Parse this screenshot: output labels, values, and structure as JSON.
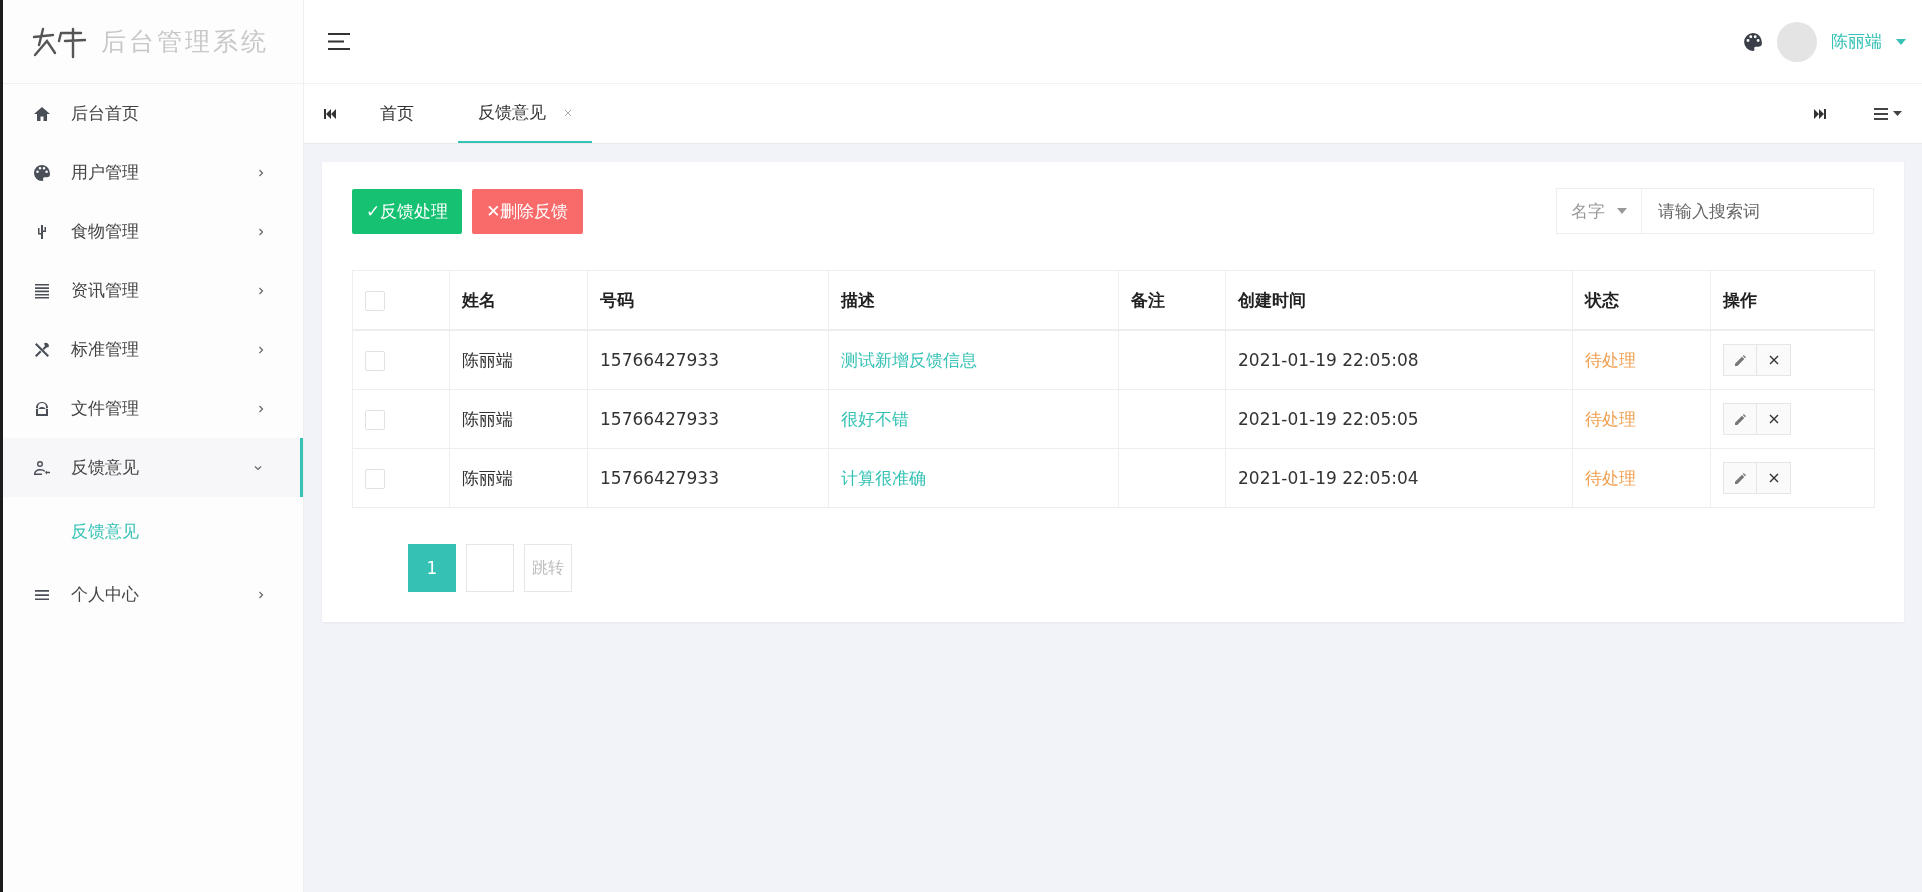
{
  "brand": {
    "title": "后台管理系统"
  },
  "sidebar": {
    "items": [
      {
        "label": "后台首页",
        "kind": "link",
        "selected": false
      },
      {
        "label": "用户管理",
        "kind": "group",
        "expanded": false,
        "selected": false
      },
      {
        "label": "食物管理",
        "kind": "group",
        "expanded": false,
        "selected": false
      },
      {
        "label": "资讯管理",
        "kind": "group",
        "expanded": false,
        "selected": false
      },
      {
        "label": "标准管理",
        "kind": "group",
        "expanded": false,
        "selected": false
      },
      {
        "label": "文件管理",
        "kind": "group",
        "expanded": false,
        "selected": false
      },
      {
        "label": "反馈意见",
        "kind": "group",
        "expanded": true,
        "selected": true,
        "children": [
          {
            "label": "反馈意见",
            "selected": true
          }
        ]
      },
      {
        "label": "个人中心",
        "kind": "group",
        "expanded": false,
        "selected": false
      }
    ]
  },
  "header": {
    "user": "陈丽端"
  },
  "tabs": [
    {
      "label": "首页",
      "selected": false,
      "closable": false
    },
    {
      "label": "反馈意见",
      "selected": true,
      "closable": true
    }
  ],
  "toolbar": {
    "buttons": [
      {
        "label": "✓反馈处理",
        "kind": "primary"
      },
      {
        "label": "✕删除反馈",
        "kind": "danger"
      }
    ],
    "search_by": "名字",
    "search": {
      "placeholder": "请输入搜索词"
    }
  },
  "table": {
    "header_checked": false,
    "columns": [
      "姓名",
      "号码",
      "描述",
      "备注",
      "创建时间",
      "状态",
      "操作"
    ],
    "rows": [
      {
        "checked": false,
        "name": "陈丽端",
        "phone": "15766427933",
        "description": "测试新增反馈信息",
        "created": "2021-01-19 22:05:08",
        "status": "待处理"
      },
      {
        "checked": false,
        "name": "陈丽端",
        "phone": "15766427933",
        "description": "很好不错",
        "created": "2021-01-19 22:05:05",
        "status": "待处理"
      },
      {
        "checked": false,
        "name": "陈丽端",
        "phone": "15766427933",
        "description": "计算很准确",
        "created": "2021-01-19 22:05:04",
        "status": "待处理"
      }
    ]
  },
  "pagination": {
    "pages": [
      {
        "label": "1",
        "selected": true
      }
    ],
    "jump": "跳转"
  }
}
